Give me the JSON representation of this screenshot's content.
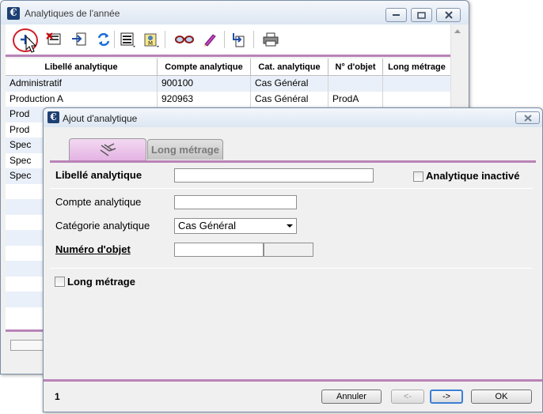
{
  "main_window": {
    "title": "Analytiques de l'année",
    "app_icon_letter": "€",
    "toolbar": {
      "buttons": [
        "add-icon",
        "delete-card-icon",
        "import-icon",
        "refresh-icon",
        "print-list-icon",
        "merge-icon",
        "glasses-icon",
        "pencil-icon",
        "export-icon",
        "printer-icon"
      ]
    },
    "grid": {
      "columns": [
        "Libellé analytique",
        "Compte analytique",
        "Cat. analytique",
        "N° d'objet",
        "Long métrage"
      ],
      "rows": [
        [
          "Administratif",
          "900100",
          "Cas Général",
          "",
          ""
        ],
        [
          "Production A",
          "920963",
          "Cas Général",
          "ProdA",
          ""
        ],
        [
          "Prod",
          "",
          "",
          "",
          ""
        ],
        [
          "Prod",
          "",
          "",
          "",
          ""
        ],
        [
          "Spec",
          "",
          "",
          "",
          ""
        ],
        [
          "Spec",
          "",
          "",
          "",
          ""
        ],
        [
          "Spec",
          "",
          "",
          "",
          ""
        ],
        [
          "",
          "",
          "",
          "",
          ""
        ],
        [
          "",
          "",
          "",
          "",
          ""
        ],
        [
          "",
          "",
          "",
          "",
          ""
        ],
        [
          "",
          "",
          "",
          "",
          ""
        ],
        [
          "",
          "",
          "",
          "",
          ""
        ],
        [
          "",
          "",
          "",
          "",
          ""
        ],
        [
          "",
          "",
          "",
          "",
          ""
        ],
        [
          "",
          "",
          "",
          "",
          ""
        ],
        [
          "",
          "",
          "",
          "",
          ""
        ]
      ]
    }
  },
  "dialog": {
    "title": "Ajout d'analytique",
    "app_icon_letter": "€",
    "tabs": {
      "second_label": "Long métrage"
    },
    "form": {
      "libelle_label": "Libellé analytique",
      "libelle_value": "",
      "inactive_label": "Analytique inactivé",
      "compte_label": "Compte analytique",
      "compte_value": "",
      "categorie_label": "Catégorie analytique",
      "categorie_value": "Cas Général",
      "numero_label": "Numéro d'objet",
      "numero_value": "",
      "long_metrage_label": "Long métrage"
    },
    "footer": {
      "record_number": "1",
      "cancel_label": "Annuler",
      "prev_label": "<-",
      "next_label": "->",
      "ok_label": "OK"
    }
  },
  "colors": {
    "accent_pink": "#b983b7",
    "tab_active": "#e4b3e3",
    "row_alt": "#eaf0f9",
    "highlight_red": "#d0202a"
  }
}
